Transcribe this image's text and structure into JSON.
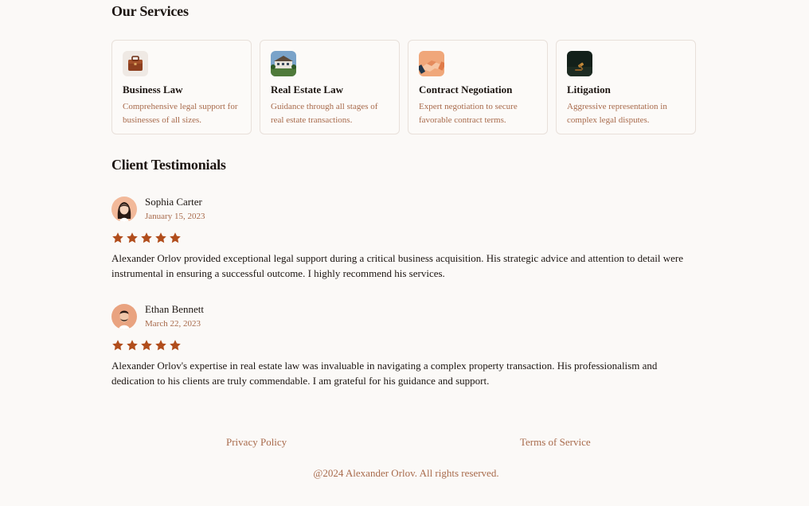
{
  "services": {
    "heading": "Our Services",
    "items": [
      {
        "icon": "briefcase-icon",
        "title": "Business Law",
        "description": "Comprehensive legal support for businesses of all sizes."
      },
      {
        "icon": "house-icon",
        "title": "Real Estate Law",
        "description": "Guidance through all stages of real estate transactions."
      },
      {
        "icon": "handshake-icon",
        "title": "Contract Negotiation",
        "description": "Expert negotiation to secure favorable contract terms."
      },
      {
        "icon": "gavel-icon",
        "title": "Litigation",
        "description": "Aggressive representation in complex legal disputes."
      }
    ]
  },
  "testimonials": {
    "heading": "Client Testimonials",
    "items": [
      {
        "name": "Sophia Carter",
        "date": "January 15, 2023",
        "rating": 5,
        "text": "Alexander Orlov provided exceptional legal support during a critical business acquisition. His strategic advice and attention to detail were instrumental in ensuring a successful outcome. I highly recommend his services."
      },
      {
        "name": "Ethan Bennett",
        "date": "March 22, 2023",
        "rating": 5,
        "text": "Alexander Orlov's expertise in real estate law was invaluable in navigating a complex property transaction. His professionalism and dedication to his clients are truly commendable. I am grateful for his guidance and support."
      }
    ]
  },
  "footer": {
    "privacy": "Privacy Policy",
    "terms": "Terms of Service",
    "copyright": "@2024 Alexander Orlov. All rights reserved."
  },
  "colors": {
    "background": "#fbf9f7",
    "accent": "#a86a4b",
    "star": "#b14d1c",
    "text": "#1c1511",
    "card_border": "#e8e0da"
  }
}
